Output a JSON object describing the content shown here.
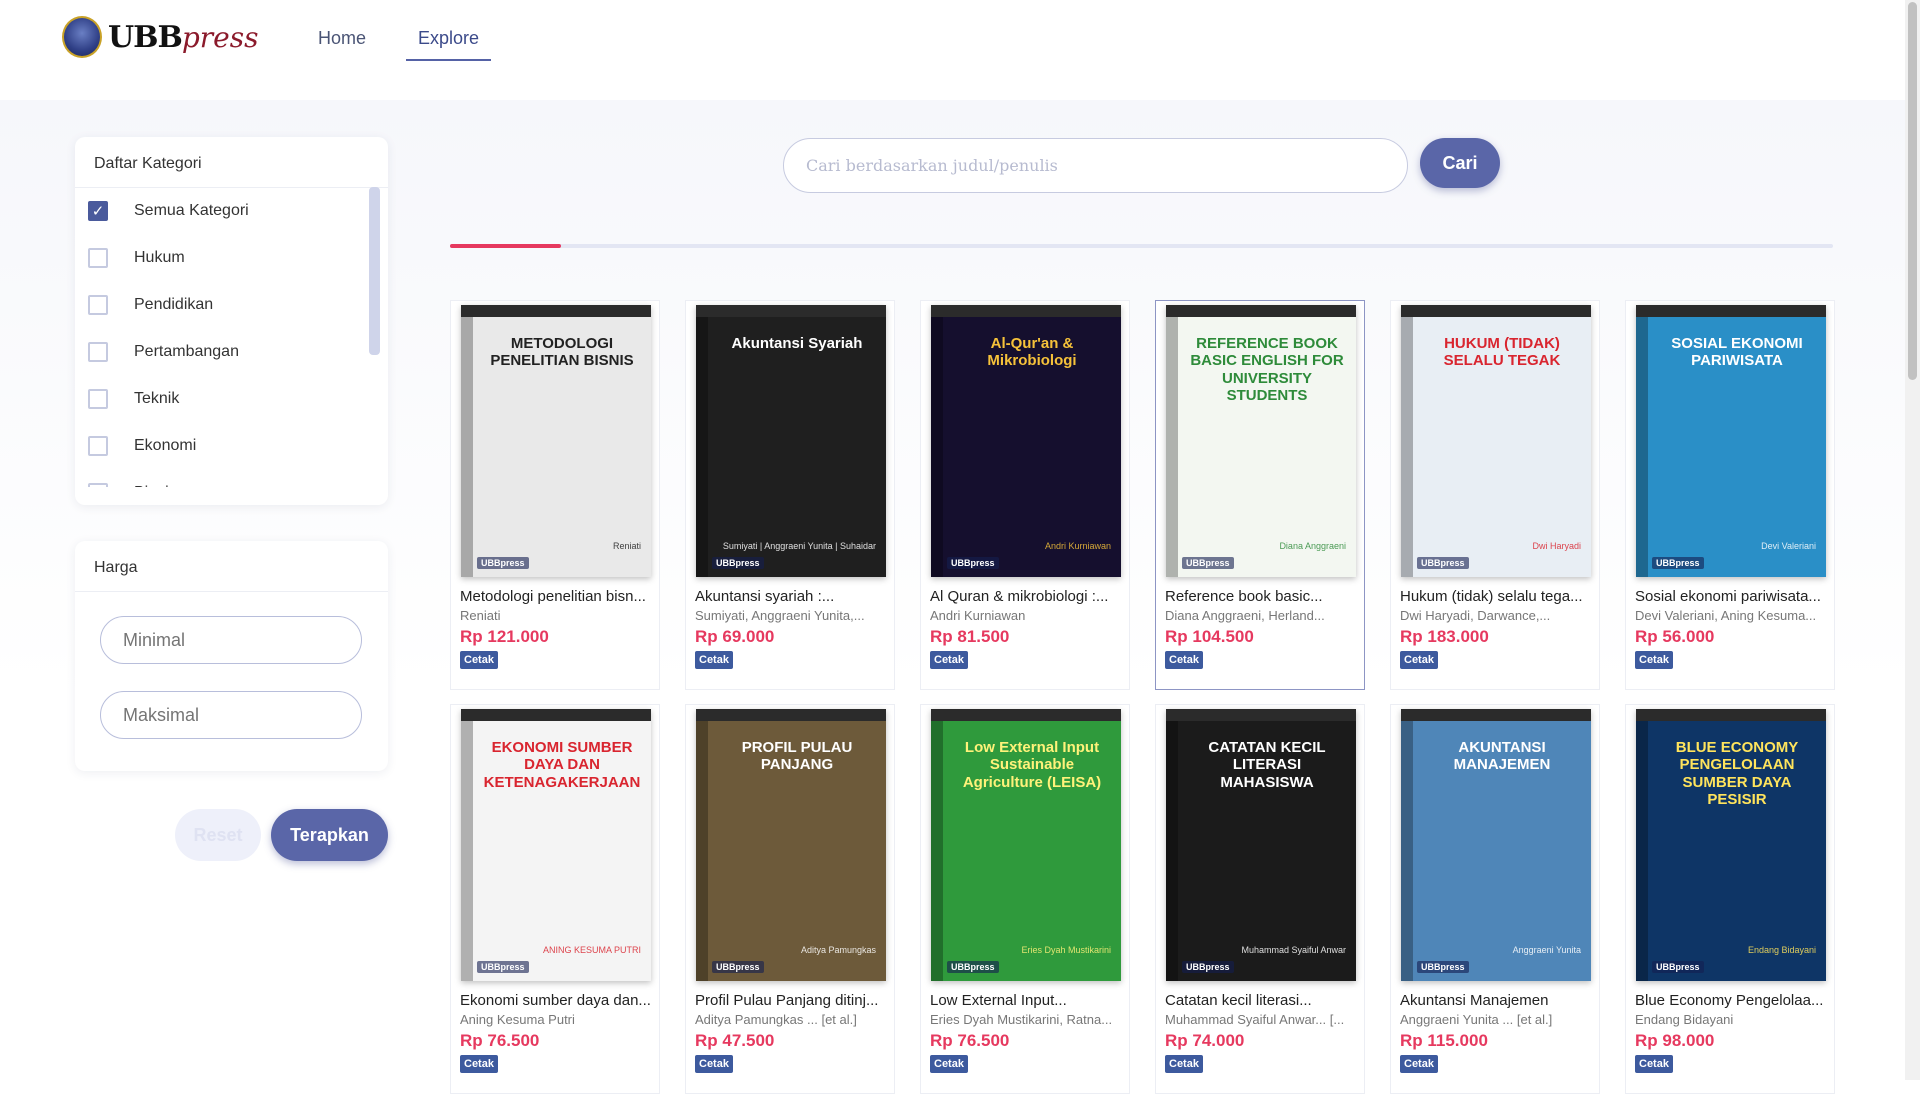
{
  "brand": {
    "name_main": "UBB",
    "name_sub": "press"
  },
  "nav": [
    {
      "label": "Home",
      "active": false
    },
    {
      "label": "Explore",
      "active": true
    }
  ],
  "sidebar": {
    "category_title": "Daftar Kategori",
    "categories": [
      {
        "label": "Semua Kategori",
        "checked": true
      },
      {
        "label": "Hukum",
        "checked": false
      },
      {
        "label": "Pendidikan",
        "checked": false
      },
      {
        "label": "Pertambangan",
        "checked": false
      },
      {
        "label": "Teknik",
        "checked": false
      },
      {
        "label": "Ekonomi",
        "checked": false
      },
      {
        "label": "Bisnis",
        "checked": false
      }
    ],
    "price_title": "Harga",
    "min_placeholder": "Minimal",
    "max_placeholder": "Maksimal",
    "reset_label": "Reset",
    "apply_label": "Terapkan"
  },
  "search": {
    "placeholder": "Cari berdasarkan judul/penulis",
    "button_label": "Cari",
    "progress": 0.08
  },
  "colors": {
    "accent": "#5a66a8",
    "price": "#e6395f",
    "badge": "#3d5a9e"
  },
  "books": [
    {
      "title": "Metodologi penelitian bisn...",
      "author": "Reniati",
      "price": "Rp 121.000",
      "badge": "Cetak",
      "cover_title": "METODOLOGI PENELITIAN BISNIS",
      "cover_author": "Reniati",
      "cover_bg": "#e9e9e9",
      "cover_fg": "#222222"
    },
    {
      "title": "Akuntansi syariah :...",
      "author": "Sumiyati, Anggraeni Yunita,...",
      "price": "Rp 69.000",
      "badge": "Cetak",
      "cover_title": "Akuntansi Syariah",
      "cover_author": "Sumiyati | Anggraeni Yunita | Suhaidar",
      "cover_bg": "#1f1f1f",
      "cover_fg": "#ffffff"
    },
    {
      "title": "Al Quran & mikrobiologi :...",
      "author": "Andri Kurniawan",
      "price": "Rp 81.500",
      "badge": "Cetak",
      "cover_title": "Al-Qur'an & Mikrobiologi",
      "cover_author": "Andri Kurniawan",
      "cover_bg": "#150f2e",
      "cover_fg": "#f6c23a"
    },
    {
      "title": "Reference book basic...",
      "author": "Diana Anggraeni, Herland...",
      "price": "Rp 104.500",
      "badge": "Cetak",
      "cover_title": "REFERENCE BOOK BASIC ENGLISH FOR UNIVERSITY STUDENTS",
      "cover_author": "Diana Anggraeni",
      "cover_bg": "#f3f7f1",
      "cover_fg": "#2e8b3a"
    },
    {
      "title": "Hukum (tidak) selalu tega...",
      "author": "Dwi Haryadi, Darwance,...",
      "price": "Rp 183.000",
      "badge": "Cetak",
      "cover_title": "HUKUM (TIDAK) SELALU TEGAK",
      "cover_author": "Dwi Haryadi",
      "cover_bg": "#e8eef4",
      "cover_fg": "#d9252f"
    },
    {
      "title": "Sosial ekonomi pariwisata...",
      "author": "Devi Valeriani, Aning Kesuma...",
      "price": "Rp 56.000",
      "badge": "Cetak",
      "cover_title": "SOSIAL EKONOMI PARIWISATA",
      "cover_author": "Devi Valeriani",
      "cover_bg": "#2a8fc7",
      "cover_fg": "#ffffff"
    },
    {
      "title": "Ekonomi sumber daya dan...",
      "author": "Aning Kesuma Putri",
      "price": "Rp 76.500",
      "badge": "Cetak",
      "cover_title": "EKONOMI SUMBER DAYA DAN KETENAGAKERJAAN",
      "cover_author": "ANING KESUMA PUTRI",
      "cover_bg": "#f4f4f4",
      "cover_fg": "#d9252f"
    },
    {
      "title": "Profil Pulau Panjang ditinj...",
      "author": "Aditya Pamungkas ... [et al.]",
      "price": "Rp 47.500",
      "badge": "Cetak",
      "cover_title": "PROFIL PULAU PANJANG",
      "cover_author": "Aditya Pamungkas",
      "cover_bg": "#6d5a3a",
      "cover_fg": "#ffffff"
    },
    {
      "title": "Low External Input...",
      "author": "Eries Dyah Mustikarini, Ratna...",
      "price": "Rp 76.500",
      "badge": "Cetak",
      "cover_title": "Low External Input Sustainable Agriculture (LEISA)",
      "cover_author": "Eries Dyah Mustikarini",
      "cover_bg": "#2f9a3c",
      "cover_fg": "#fff27a"
    },
    {
      "title": "Catatan kecil literasi...",
      "author": "Muhammad Syaiful Anwar... [...",
      "price": "Rp 74.000",
      "badge": "Cetak",
      "cover_title": "CATATAN KECIL LITERASI MAHASISWA",
      "cover_author": "Muhammad Syaiful Anwar",
      "cover_bg": "#1b1b1b",
      "cover_fg": "#ffffff"
    },
    {
      "title": "Akuntansi Manajemen",
      "author": "Anggraeni Yunita ... [et al.]",
      "price": "Rp 115.000",
      "badge": "Cetak",
      "cover_title": "AKUNTANSI MANAJEMEN",
      "cover_author": "Anggraeni Yunita",
      "cover_bg": "#4f86b8",
      "cover_fg": "#ffffff"
    },
    {
      "title": "Blue Economy Pengelolaa...",
      "author": "Endang Bidayani",
      "price": "Rp 98.000",
      "badge": "Cetak",
      "cover_title": "BLUE ECONOMY PENGELOLAAN SUMBER DAYA PESISIR",
      "cover_author": "Endang Bidayani",
      "cover_bg": "#0e3566",
      "cover_fg": "#ffe45c"
    }
  ]
}
